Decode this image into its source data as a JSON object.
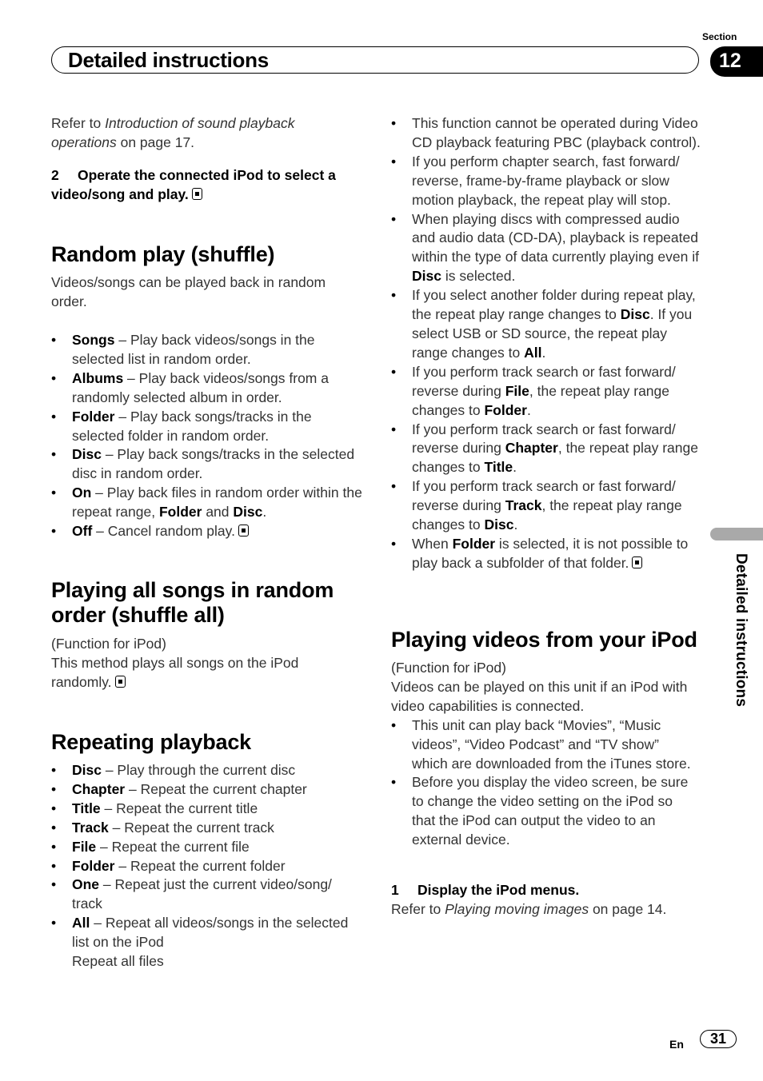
{
  "header": {
    "title": "Detailed instructions",
    "section_label": "Section",
    "section_number": "12"
  },
  "side_tab": {
    "label": "Detailed instructions"
  },
  "footer": {
    "language": "En",
    "page_number": "31"
  },
  "left_column": {
    "intro": {
      "prefix": "Refer to ",
      "link": "Introduction of sound playback operations",
      "suffix": " on page 17."
    },
    "step2": {
      "number": "2",
      "text": "Operate the connected iPod to select a video/song and play."
    },
    "random_play": {
      "title": "Random play (shuffle)",
      "desc": "Videos/songs can be played back in random order.",
      "items": [
        {
          "term": "Songs",
          "text": " – Play back videos/songs in the selected list in random order."
        },
        {
          "term": "Albums",
          "text": " – Play back videos/songs from a randomly selected album in order."
        },
        {
          "term": "Folder",
          "text": " – Play back songs/tracks in the selected folder in random order."
        },
        {
          "term": "Disc",
          "text": " – Play back songs/tracks in the selected disc in random order."
        },
        {
          "term": "On",
          "text": " – Play back files in random order within the repeat range, ",
          "term2": "Folder",
          "mid": " and ",
          "term3": "Disc",
          "end": "."
        },
        {
          "term": "Off",
          "text": " – Cancel random play."
        }
      ]
    },
    "shuffle_all": {
      "title": "Playing all songs in random order (shuffle all)",
      "function_note": "(Function for iPod)",
      "desc": "This method plays all songs on the iPod randomly."
    },
    "repeat": {
      "title": "Repeating playback",
      "items": [
        {
          "term": "Disc",
          "text": " – Play through the current disc"
        },
        {
          "term": "Chapter",
          "text": " – Repeat the current chapter"
        },
        {
          "term": "Title",
          "text": " – Repeat the current title"
        },
        {
          "term": "Track",
          "text": " – Repeat the current track"
        },
        {
          "term": "File",
          "text": " – Repeat the current file"
        },
        {
          "term": "Folder",
          "text": " – Repeat the current folder"
        },
        {
          "term": "One",
          "text": " – Repeat just the current video/song/ track"
        },
        {
          "term": "All",
          "text": " – Repeat all videos/songs in the selected list on the iPod",
          "extra": "Repeat all files"
        }
      ]
    }
  },
  "right_column": {
    "notes": [
      {
        "parts": [
          [
            "This function cannot be operated during Video CD playback featuring PBC (playback control).",
            false
          ]
        ]
      },
      {
        "parts": [
          [
            "If you perform chapter search, fast forward/ reverse, frame-by-frame playback or slow motion playback, the repeat play will stop.",
            false
          ]
        ]
      },
      {
        "parts": [
          [
            "When playing discs with compressed audio and audio data (CD-DA), playback is repeated within the type of data currently playing even if ",
            false
          ],
          [
            "Disc",
            true
          ],
          [
            " is selected.",
            false
          ]
        ]
      },
      {
        "parts": [
          [
            "If you select another folder during repeat play, the repeat play range changes to ",
            false
          ],
          [
            "Disc",
            true
          ],
          [
            ". If you select USB or SD source, the repeat play range changes to ",
            false
          ],
          [
            "All",
            true
          ],
          [
            ".",
            false
          ]
        ]
      },
      {
        "parts": [
          [
            "If you perform track search or fast forward/ reverse during ",
            false
          ],
          [
            "File",
            true
          ],
          [
            ", the repeat play range changes to ",
            false
          ],
          [
            "Folder",
            true
          ],
          [
            ".",
            false
          ]
        ]
      },
      {
        "parts": [
          [
            "If you perform track search or fast forward/ reverse during ",
            false
          ],
          [
            "Chapter",
            true
          ],
          [
            ", the repeat play range changes to ",
            false
          ],
          [
            "Title",
            true
          ],
          [
            ".",
            false
          ]
        ]
      },
      {
        "parts": [
          [
            "If you perform track search or fast forward/ reverse during ",
            false
          ],
          [
            "Track",
            true
          ],
          [
            ", the repeat play range changes to ",
            false
          ],
          [
            "Disc",
            true
          ],
          [
            ".",
            false
          ]
        ]
      },
      {
        "parts": [
          [
            "When ",
            false
          ],
          [
            "Folder",
            true
          ],
          [
            " is selected, it is not possible to play back a subfolder of that folder.",
            false
          ]
        ],
        "end_mark": true
      }
    ],
    "videos": {
      "title": "Playing videos from your iPod",
      "function_note": "(Function for iPod)",
      "desc": "Videos can be played on this unit if an iPod with video capabilities is connected.",
      "items": [
        "This unit can play back “Movies”, “Music videos”, “Video Podcast” and “TV show” which are downloaded from the iTunes store.",
        "Before you display the video screen, be sure to change the video setting on the iPod so that the iPod can output the video to an external device."
      ],
      "step1": {
        "number": "1",
        "text": "Display the iPod menus."
      },
      "refer": {
        "prefix": "Refer to ",
        "link": "Playing moving images",
        "suffix": " on page 14."
      }
    }
  }
}
